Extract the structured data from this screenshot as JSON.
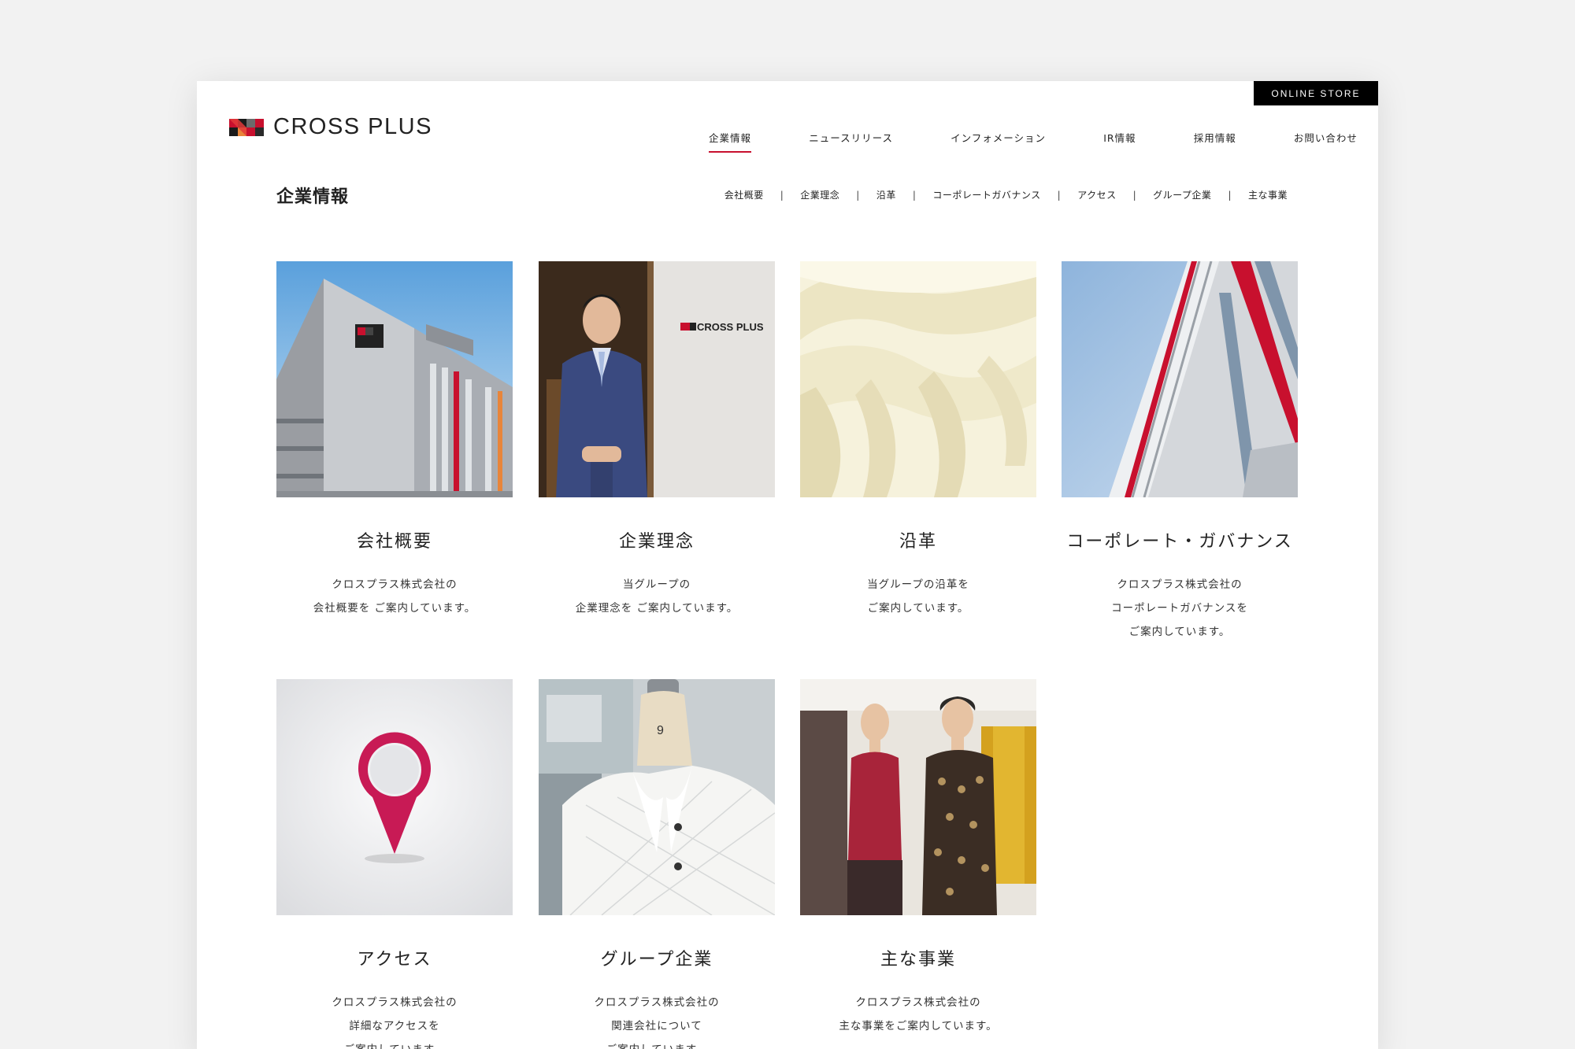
{
  "header": {
    "online_store": "ONLINE STORE",
    "logo_text": "CROSS PLUS"
  },
  "gnav": [
    {
      "label": "企業情報",
      "active": true
    },
    {
      "label": "ニュースリリース"
    },
    {
      "label": "インフォメーション"
    },
    {
      "label": "IR情報"
    },
    {
      "label": "採用情報"
    },
    {
      "label": "お問い合わせ"
    }
  ],
  "page_title": "企業情報",
  "subnav": [
    "会社概要",
    "企業理念",
    "沿革",
    "コーポレートガバナンス",
    "アクセス",
    "グループ企業",
    "主な事業"
  ],
  "subnav_separator": "|",
  "cards": [
    {
      "title": "会社概要",
      "desc": [
        "クロスプラス株式会社の",
        "会社概要を ご案内しています。"
      ],
      "image": "building-photo"
    },
    {
      "title": "企業理念",
      "desc": [
        "当グループの",
        "企業理念を ご案内しています。"
      ],
      "image": "executive-photo"
    },
    {
      "title": "沿革",
      "desc": [
        "当グループの沿革を",
        "ご案内しています。"
      ],
      "image": "fabric-photo"
    },
    {
      "title": "コーポレート・ガバナンス",
      "desc": [
        "クロスプラス株式会社の",
        "コーポレートガバナンスを",
        "ご案内しています。"
      ],
      "image": "tower-photo"
    },
    {
      "title": "アクセス",
      "desc": [
        "クロスプラス株式会社の",
        "詳細なアクセスを",
        "ご案内しています。"
      ],
      "image": "map-pin-photo"
    },
    {
      "title": "グループ企業",
      "desc": [
        "クロスプラス株式会社の",
        "関連会社について",
        "ご案内しています。"
      ],
      "image": "mannequin-jacket-photo"
    },
    {
      "title": "主な事業",
      "desc": [
        "クロスプラス株式会社の",
        "主な事業をご案内しています。"
      ],
      "image": "store-mannequins-photo"
    }
  ],
  "photo_sign_text": "CROSS PLUS",
  "colors": {
    "accent": "#c8102e",
    "black": "#000000",
    "background": "#f2f2f2"
  }
}
